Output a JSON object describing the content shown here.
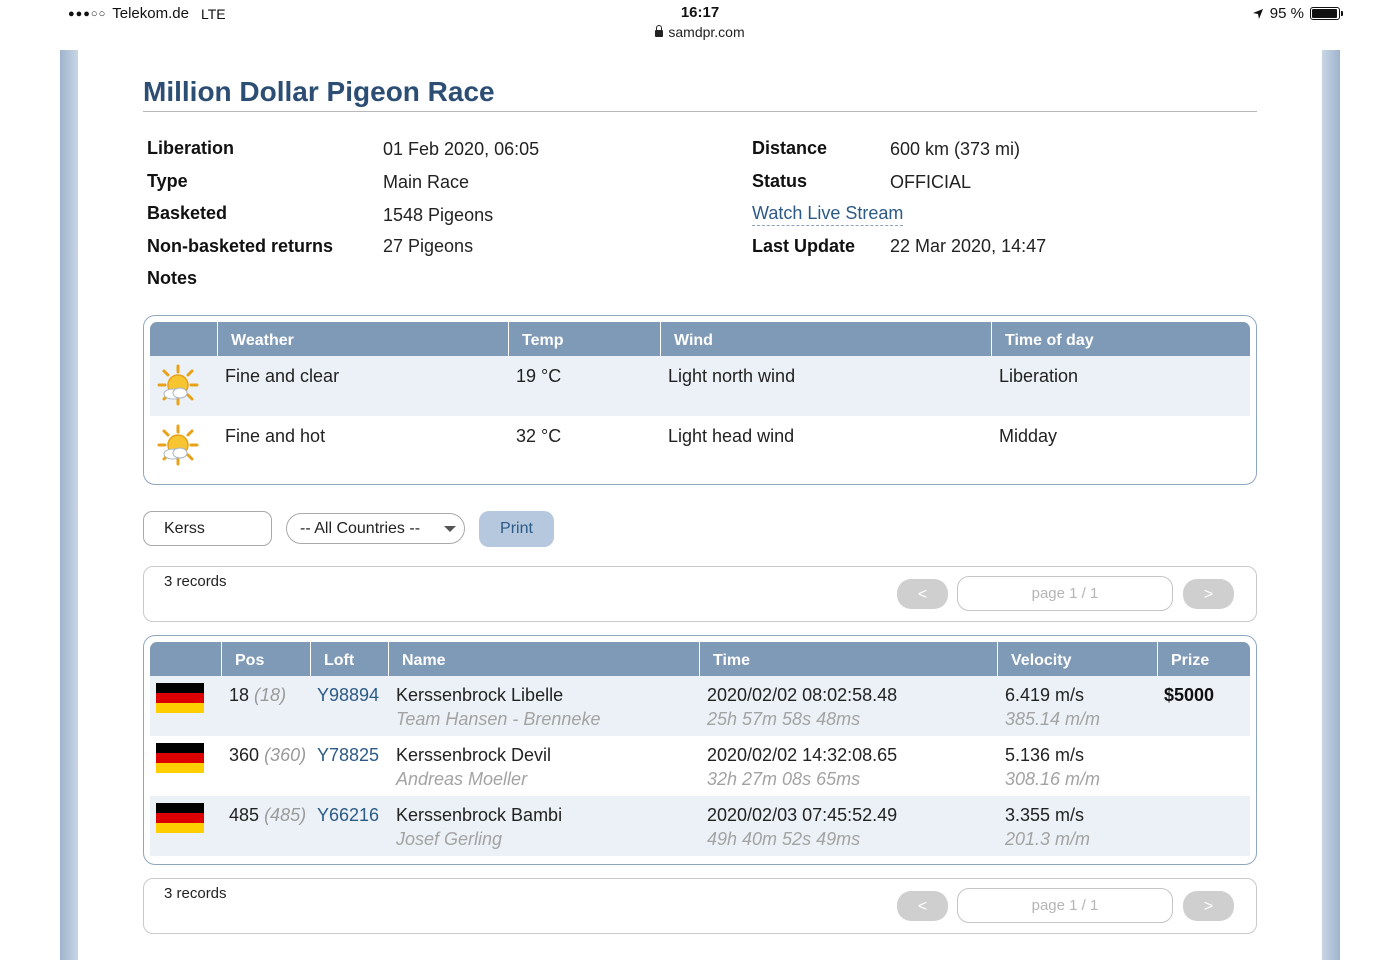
{
  "status_bar": {
    "signal": "●●●○○",
    "carrier": "Telekom.de",
    "network": "LTE",
    "time": "16:17",
    "url": "samdpr.com",
    "battery": "95 %",
    "battery_level": 0.95
  },
  "page": {
    "title": "Million Dollar Pigeon Race"
  },
  "race_info": {
    "left": [
      {
        "label": "Liberation",
        "value": "01 Feb 2020, 06:05"
      },
      {
        "label": "Type",
        "value": "Main Race"
      },
      {
        "label": "Basketed",
        "value": "1548 Pigeons"
      },
      {
        "label": "Non-basketed returns",
        "value": "27 Pigeons"
      },
      {
        "label": "Notes",
        "value": ""
      }
    ],
    "right": [
      {
        "label": "Distance",
        "value": "600 km (373 mi)"
      },
      {
        "label": "Status",
        "value": "OFFICIAL"
      },
      {
        "label": "Last Update",
        "value": "22 Mar 2020, 14:47"
      }
    ],
    "live_stream_link": "Watch Live Stream"
  },
  "weather_table": {
    "headers": [
      "",
      "Weather",
      "Temp",
      "Wind",
      "Time of day"
    ],
    "rows": [
      {
        "icon": "sun-cloud-icon",
        "weather": "Fine and clear",
        "temp": "19 °C",
        "wind": "Light north wind",
        "time_of_day": "Liberation"
      },
      {
        "icon": "sun-cloud-icon",
        "weather": "Fine and hot",
        "temp": "32 °C",
        "wind": "Light head wind",
        "time_of_day": "Midday"
      }
    ]
  },
  "filters": {
    "search_value": "Kerss",
    "country_select": "-- All Countries --",
    "print_label": "Print"
  },
  "pager": {
    "records_label": "3 records",
    "prev_label": "<",
    "next_label": ">",
    "page_label": "page 1 / 1"
  },
  "results_table": {
    "headers": [
      "",
      "Pos",
      "Loft",
      "Name",
      "Time",
      "Velocity",
      "Prize"
    ],
    "rows": [
      {
        "flag": "germany-flag",
        "pos": "18",
        "pos_paren": "(18)",
        "loft": "Y98894",
        "name": "Kerssenbrock Libelle",
        "team": "Team Hansen - Brenneke",
        "time": "2020/02/02 08:02:58.48",
        "duration": "25h 57m 58s 48ms",
        "velocity": "6.419 m/s",
        "velocity_mpm": "385.14 m/m",
        "prize": "$5000"
      },
      {
        "flag": "germany-flag",
        "pos": "360",
        "pos_paren": "(360)",
        "loft": "Y78825",
        "name": "Kerssenbrock Devil",
        "team": "Andreas Moeller",
        "time": "2020/02/02 14:32:08.65",
        "duration": "32h 27m 08s 65ms",
        "velocity": "5.136 m/s",
        "velocity_mpm": "308.16 m/m",
        "prize": ""
      },
      {
        "flag": "germany-flag",
        "pos": "485",
        "pos_paren": "(485)",
        "loft": "Y66216",
        "name": "Kerssenbrock Bambi",
        "team": "Josef Gerling",
        "time": "2020/02/03 07:45:52.49",
        "duration": "49h 40m 52s 49ms",
        "velocity": "3.355 m/s",
        "velocity_mpm": "201.3 m/m",
        "prize": ""
      }
    ]
  },
  "colors": {
    "title": "#2c4e74",
    "header_bg": "#7f9ab7",
    "link": "#2c5a86",
    "row_alt": "#ebf1f6"
  }
}
